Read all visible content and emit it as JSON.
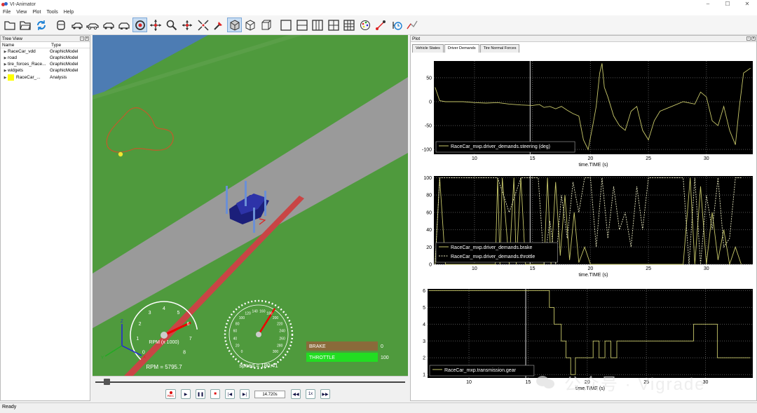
{
  "window": {
    "title": "VI-Animator",
    "controls": [
      "–",
      "☐",
      "✕"
    ]
  },
  "menu": [
    "File",
    "View",
    "Plot",
    "Tools",
    "Help"
  ],
  "toolbar_icons": [
    "open-file-icon",
    "open-folder-icon",
    "reload-icon",
    "car-front-icon",
    "car-side-icon",
    "car-side-outline-icon",
    "car-rear-icon",
    "car-iso-icon",
    "rotate-view-icon",
    "pan-icon",
    "zoom-icon",
    "fit-view-icon",
    "expand-icon",
    "pick-icon",
    "shaded-cube-icon",
    "wireframe-cube-icon",
    "box-cube-icon",
    "layout-single-icon",
    "layout-hsplit-icon",
    "layout-vsplit-icon",
    "layout-quad-icon",
    "layout-grid-icon",
    "palette-icon",
    "record-path-icon",
    "timer-icon",
    "measure-icon"
  ],
  "tree": {
    "title": "Tree View",
    "col_name": "Name",
    "col_type": "Type",
    "rows": [
      {
        "name": "RaceCar_vdd",
        "type": "GraphicModel"
      },
      {
        "name": "road",
        "type": "GraphicModel"
      },
      {
        "name": "tire_forces_Race...",
        "type": "GraphicModel"
      },
      {
        "name": "widgets",
        "type": "GraphicModel"
      },
      {
        "name": "RaceCar_...",
        "type": "Analysis",
        "swatch": "#ffff00"
      }
    ]
  },
  "viewport": {
    "rpm_scale": [
      "0",
      "1",
      "2",
      "3",
      "4",
      "5",
      "6",
      "7",
      "8"
    ],
    "rpm_label": "RPM (x 1000)",
    "rpm_readout": "RPM = 5795.7",
    "rpm_value": 5795.7,
    "speed_scale": [
      "0",
      "20",
      "40",
      "60",
      "80",
      "100",
      "120",
      "140",
      "160",
      "180",
      "200",
      "220",
      "240",
      "260",
      "280",
      "300"
    ],
    "speed_readout": "speed = 180.41",
    "speed_value": 180.41,
    "brake": {
      "label": "BRAKE",
      "value": "0",
      "fraction": 0
    },
    "throttle": {
      "label": "THROTTLE",
      "value": "100",
      "fraction": 1
    },
    "axis_labels": {
      "x": "X",
      "y": "Y",
      "z": "Z"
    }
  },
  "playback": {
    "time": "14.720s",
    "position_fraction": 0.44,
    "rec": "REC",
    "speed_btn": "1x"
  },
  "plot": {
    "title": "Plot",
    "tabs": [
      "Vehicle States",
      "Driver Demands",
      "Tire Normal Forces"
    ],
    "active_tab": "Driver Demands"
  },
  "chart_data": [
    {
      "type": "line",
      "title": "",
      "xlabel": "time.TIME (s)",
      "ylabel": "",
      "xlim": [
        6.5,
        34
      ],
      "ylim": [
        -110,
        85
      ],
      "xticks": [
        "10",
        "15",
        "20",
        "25",
        "30"
      ],
      "yticks": [
        "50",
        "0",
        "-50",
        "-100"
      ],
      "cursor_x": 14.8,
      "grid": true,
      "legend_position": "bottom-left",
      "series": [
        {
          "name": "RaceCar_mxp.driver_demands.steering (deg)",
          "color": "#c8c86a",
          "style": "solid",
          "x": [
            6.6,
            7.0,
            7.5,
            8,
            9,
            10,
            11,
            12,
            13,
            14,
            15,
            15.6,
            16,
            16.5,
            17,
            17.5,
            18,
            18.5,
            19,
            19.4,
            19.8,
            20.2,
            20.5,
            20.8,
            21,
            21.2,
            21.5,
            22,
            22.5,
            23,
            23.5,
            24,
            24.5,
            25,
            25.5,
            26,
            26.5,
            27,
            28,
            29,
            29.5,
            30,
            30.5,
            31,
            31.5,
            32,
            32.5,
            32.8,
            33.2,
            33.8
          ],
          "y": [
            30,
            2,
            0,
            0,
            0,
            -2,
            -3,
            -2,
            -5,
            -7,
            -8,
            -6,
            -12,
            -10,
            -15,
            -10,
            -18,
            -25,
            -30,
            -80,
            -100,
            -50,
            -10,
            60,
            80,
            30,
            10,
            -30,
            -50,
            -60,
            -20,
            -10,
            -60,
            -80,
            -40,
            -20,
            -15,
            -10,
            0,
            -5,
            20,
            10,
            -40,
            -50,
            -10,
            -60,
            -90,
            -20,
            60,
            70
          ]
        }
      ]
    },
    {
      "type": "line",
      "title": "",
      "xlabel": "time.TIME (s)",
      "ylabel": "",
      "xlim": [
        6.5,
        34
      ],
      "ylim": [
        0,
        102
      ],
      "xticks": [
        "10",
        "15",
        "20",
        "25",
        "30"
      ],
      "yticks": [
        "100",
        "80",
        "60",
        "40",
        "20",
        "0"
      ],
      "cursor_x": 14.8,
      "grid": true,
      "legend_position": "bottom-left",
      "series": [
        {
          "name": "RaceCar_mxp.driver_demands.brake",
          "color": "#c8c86a",
          "style": "solid",
          "x": [
            6.6,
            7,
            7.5,
            8,
            10,
            11.8,
            12,
            12.2,
            12.4,
            13,
            13.4,
            13.6,
            14,
            14.4,
            14.6,
            15,
            16,
            16.3,
            16.6,
            17,
            17.4,
            17.8,
            18.2,
            18.6,
            19,
            19.5,
            20,
            20.5,
            21,
            21.5,
            22,
            22.5,
            23,
            23.5,
            24,
            24.5,
            25,
            26,
            27,
            28,
            28.6,
            29,
            29.5,
            30,
            30.5,
            31,
            31.5,
            32,
            32.5,
            33
          ],
          "y": [
            0,
            100,
            0,
            0,
            0,
            0,
            100,
            0,
            100,
            0,
            100,
            0,
            100,
            0,
            0,
            0,
            0,
            100,
            0,
            95,
            10,
            80,
            5,
            60,
            2,
            20,
            0,
            0,
            0,
            0,
            0,
            0,
            0,
            0,
            0,
            0,
            0,
            0,
            0,
            0,
            100,
            0,
            90,
            0,
            60,
            5,
            40,
            0,
            20,
            0
          ]
        },
        {
          "name": "RaceCar_mxp.driver_demands.throttle",
          "color": "#e8e8c0",
          "style": "dashed",
          "x": [
            6.6,
            7,
            7.5,
            8,
            10,
            12,
            13,
            14,
            14.6,
            15,
            15.5,
            16,
            16.5,
            17,
            17.5,
            18,
            18.5,
            19,
            19.5,
            20,
            20.5,
            21,
            21.5,
            22,
            22.5,
            23,
            23.5,
            24,
            24.5,
            25,
            25.5,
            26,
            27,
            28,
            28.5,
            29,
            29.5,
            30,
            30.5,
            31,
            31.5,
            32,
            32.5,
            33
          ],
          "y": [
            0,
            100,
            100,
            100,
            100,
            100,
            60,
            100,
            100,
            100,
            100,
            0,
            50,
            0,
            80,
            30,
            95,
            60,
            100,
            100,
            20,
            100,
            30,
            90,
            40,
            60,
            20,
            90,
            40,
            100,
            100,
            100,
            100,
            100,
            0,
            100,
            0,
            80,
            40,
            100,
            20,
            30,
            100,
            100
          ]
        }
      ]
    },
    {
      "type": "line",
      "title": "",
      "xlabel": "time.TIME (s)",
      "ylabel": "",
      "xlim": [
        6.5,
        34
      ],
      "ylim": [
        0.8,
        6.1
      ],
      "xticks": [
        "10",
        "15",
        "20",
        "25",
        "30"
      ],
      "yticks": [
        "6",
        "5",
        "4",
        "3",
        "2",
        "1"
      ],
      "cursor_x": 14.8,
      "grid": true,
      "legend_position": "bottom-left",
      "series": [
        {
          "name": "RaceCar_mxp.transmission.gear",
          "color": "#c8c86a",
          "style": "solid",
          "x": [
            6.6,
            7.0,
            7.2,
            16.8,
            16.8,
            17.2,
            17.2,
            17.8,
            17.8,
            18.2,
            18.2,
            18.6,
            18.6,
            19.0,
            19.0,
            20.5,
            20.5,
            21.0,
            21.0,
            21.5,
            21.5,
            22.0,
            22.0,
            22.5,
            22.5,
            27,
            27,
            29,
            29,
            31,
            31,
            33.8
          ],
          "y": [
            6,
            6,
            6,
            6,
            5,
            5,
            4,
            4,
            3,
            3,
            2,
            2,
            1,
            1,
            2,
            2,
            3,
            3,
            2,
            2,
            3,
            3,
            2,
            2,
            3,
            3,
            3,
            3,
            4,
            4,
            2,
            2
          ]
        }
      ]
    }
  ],
  "watermark": "公众号 · Vigrade",
  "status": "Ready"
}
